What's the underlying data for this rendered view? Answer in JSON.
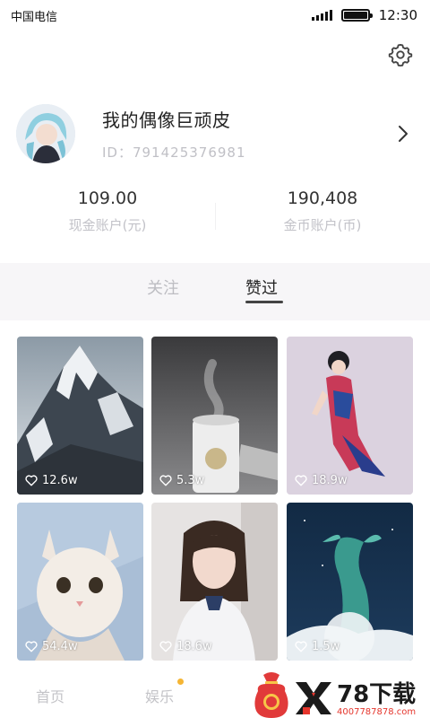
{
  "status_bar": {
    "carrier": "中国电信",
    "time": "12:30"
  },
  "profile": {
    "username": "我的偶像巨顽皮",
    "user_id": "ID：791425376981"
  },
  "stats": [
    {
      "value": "109.00",
      "label": "现金账户(元)"
    },
    {
      "value": "190,408",
      "label": "金币账户(币)"
    }
  ],
  "tabs": [
    {
      "label": "关注"
    },
    {
      "label": "赞过"
    }
  ],
  "grid": [
    {
      "likes": "12.6w",
      "subject": "snowy mountain peak"
    },
    {
      "likes": "5.3w",
      "subject": "white humidifier"
    },
    {
      "likes": "18.9w",
      "subject": "woman in qipao"
    },
    {
      "likes": "54.4w",
      "subject": "cat portrait"
    },
    {
      "likes": "18.6w",
      "subject": "girl portrait"
    },
    {
      "likes": "1.5w",
      "subject": "whale illustration"
    }
  ],
  "bottom_nav": {
    "home": "首页",
    "entertainment": "娱乐"
  },
  "watermark": {
    "brand": "78下载",
    "url": "4007787878.com"
  },
  "colors": {
    "accent_dot": "#f5b534",
    "muted_text": "#c0c0c6",
    "tab_band": "#f7f6f8"
  }
}
